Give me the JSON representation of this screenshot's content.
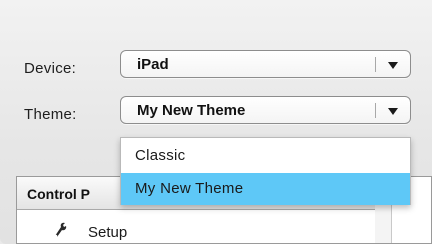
{
  "form": {
    "device_label": "Device:",
    "device_value": "iPad",
    "theme_label": "Theme:",
    "theme_value": "My New Theme"
  },
  "dropdown": {
    "options": [
      "Classic",
      "My New Theme"
    ],
    "selected": "My New Theme"
  },
  "panel": {
    "title": "Control P",
    "items": [
      {
        "label": "Setup",
        "icon": "setup-icon"
      }
    ]
  },
  "colors": {
    "selection": "#5ec8f7"
  }
}
